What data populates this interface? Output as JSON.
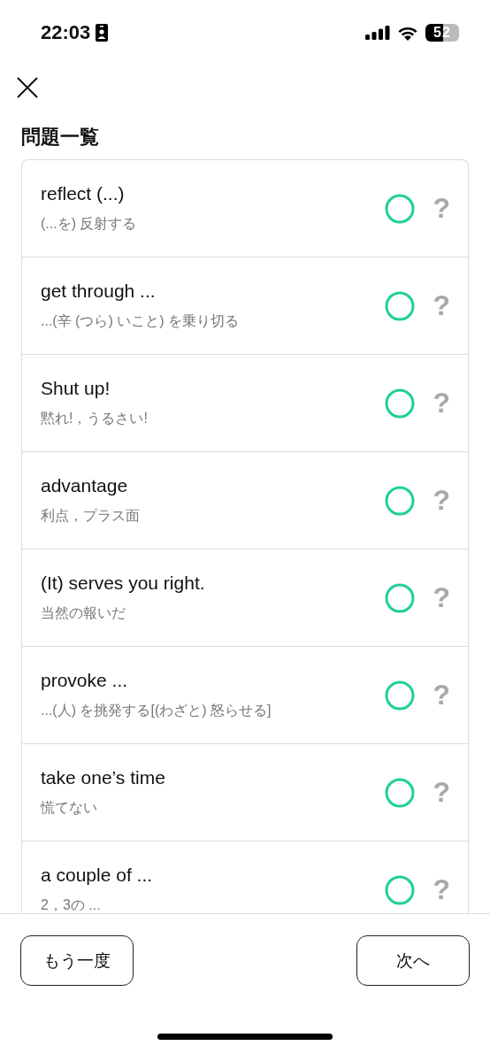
{
  "status_bar": {
    "time": "22:03",
    "battery": "52"
  },
  "title": "問題一覧",
  "questions": [
    {
      "word": "reflect (...)",
      "meaning": "(...を) 反射する",
      "correct": true,
      "mark": "?"
    },
    {
      "word": "get through ...",
      "meaning": "...(辛 (つら) いこと) を乗り切る",
      "correct": true,
      "mark": "?"
    },
    {
      "word": "Shut up!",
      "meaning": "黙れ!，うるさい!",
      "correct": true,
      "mark": "?"
    },
    {
      "word": "advantage",
      "meaning": "利点，プラス面",
      "correct": true,
      "mark": "?"
    },
    {
      "word": "(It) serves you right.",
      "meaning": "当然の報いだ",
      "correct": true,
      "mark": "?"
    },
    {
      "word": "provoke ...",
      "meaning": "...(人) を挑発する[(わざと) 怒らせる]",
      "correct": true,
      "mark": "?"
    },
    {
      "word": "take one’s time",
      "meaning": "慌てない",
      "correct": true,
      "mark": "?"
    },
    {
      "word": "a couple of ...",
      "meaning": "2，3の ...",
      "correct": true,
      "mark": "?"
    }
  ],
  "buttons": {
    "retry": "もう一度",
    "next": "次へ"
  }
}
